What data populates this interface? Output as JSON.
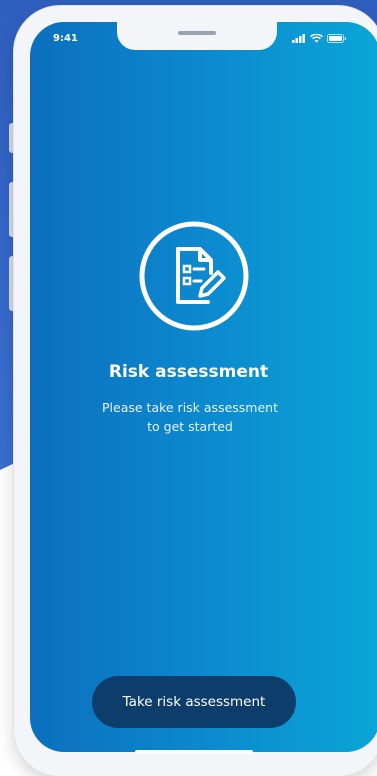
{
  "status_bar": {
    "time": "9:41",
    "icons": [
      "signal-icon",
      "wifi-icon",
      "battery-icon"
    ]
  },
  "main": {
    "icon": "document-edit-icon",
    "title": "Risk assessment",
    "subtitle_line1": "Please take risk assessment",
    "subtitle_line2": "to get started"
  },
  "cta": {
    "label": "Take risk assessment"
  },
  "colors": {
    "background_accent": "#2f5fbf",
    "screen_gradient_start": "#0c6fbe",
    "screen_gradient_end": "#0aa6d6",
    "button": "#0d3d6b",
    "text": "#ffffff"
  }
}
